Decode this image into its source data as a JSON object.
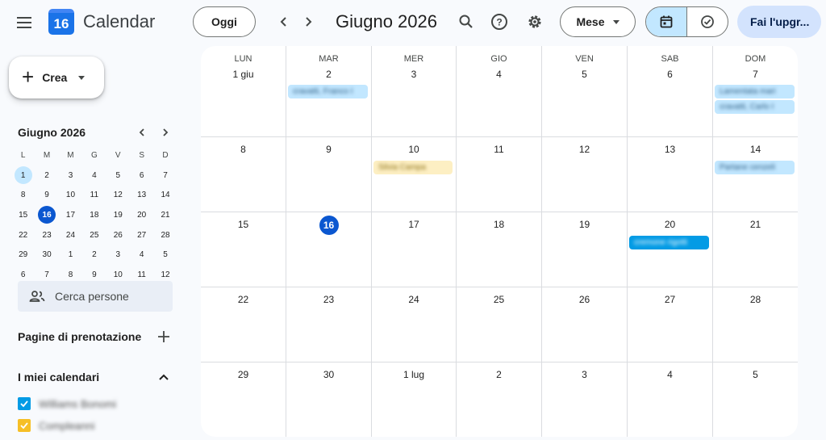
{
  "header": {
    "app_title": "Calendar",
    "logo_number": "16",
    "today_label": "Oggi",
    "month_title": "Giugno 2026",
    "view_label": "Mese",
    "upgrade_label": "Fai l'upgr..."
  },
  "sidebar": {
    "create_label": "Crea",
    "mini_calendar": {
      "title": "Giugno 2026",
      "weekdays": [
        "L",
        "M",
        "M",
        "G",
        "V",
        "S",
        "D"
      ],
      "days": [
        "1",
        "2",
        "3",
        "4",
        "5",
        "6",
        "7",
        "8",
        "9",
        "10",
        "11",
        "12",
        "13",
        "14",
        "15",
        "16",
        "17",
        "18",
        "19",
        "20",
        "21",
        "22",
        "23",
        "24",
        "25",
        "26",
        "27",
        "28",
        "29",
        "30",
        "1",
        "2",
        "3",
        "4",
        "5",
        "6",
        "7",
        "8",
        "9",
        "10",
        "11",
        "12"
      ],
      "selected_index": 0,
      "today_index": 15
    },
    "search_people_placeholder": "Cerca persone",
    "booking_pages_label": "Pagine di prenotazione",
    "my_calendars_label": "I miei calendari",
    "calendars": [
      {
        "name": "Williams Bonomi",
        "color": "#039be5"
      },
      {
        "name": "Compleanni",
        "color": "#f6bf26"
      }
    ]
  },
  "month_view": {
    "weekdays": [
      "LUN",
      "MAR",
      "MER",
      "GIO",
      "VEN",
      "SAB",
      "DOM"
    ],
    "weeks": [
      [
        "1 giu",
        "2",
        "3",
        "4",
        "5",
        "6",
        "7"
      ],
      [
        "8",
        "9",
        "10",
        "11",
        "12",
        "13",
        "14"
      ],
      [
        "15",
        "16",
        "17",
        "18",
        "19",
        "20",
        "21"
      ],
      [
        "22",
        "23",
        "24",
        "25",
        "26",
        "27",
        "28"
      ],
      [
        "29",
        "30",
        "1 lug",
        "2",
        "3",
        "4",
        "5"
      ]
    ],
    "today": "16",
    "events": [
      {
        "week": 0,
        "day": 1,
        "slot": 0,
        "title": "cravatti, Franco I",
        "bg": "#c2e7ff",
        "fg": "#2a5a80"
      },
      {
        "week": 0,
        "day": 6,
        "slot": 0,
        "title": "Lamentata mari",
        "bg": "#c2e7ff",
        "fg": "#2a5a80"
      },
      {
        "week": 0,
        "day": 6,
        "slot": 1,
        "title": "cravatti, Carlo I",
        "bg": "#c2e7ff",
        "fg": "#2a5a80"
      },
      {
        "week": 1,
        "day": 2,
        "slot": 0,
        "title": "Silvia Campa",
        "bg": "#fdefc3",
        "fg": "#8a6d10"
      },
      {
        "week": 1,
        "day": 6,
        "slot": 0,
        "title": "Partane cenzeli",
        "bg": "#c2e7ff",
        "fg": "#2a5a80"
      },
      {
        "week": 2,
        "day": 5,
        "slot": 0,
        "title": "cremone rigotti",
        "bg": "#039be5",
        "fg": "#ffffff"
      }
    ]
  }
}
